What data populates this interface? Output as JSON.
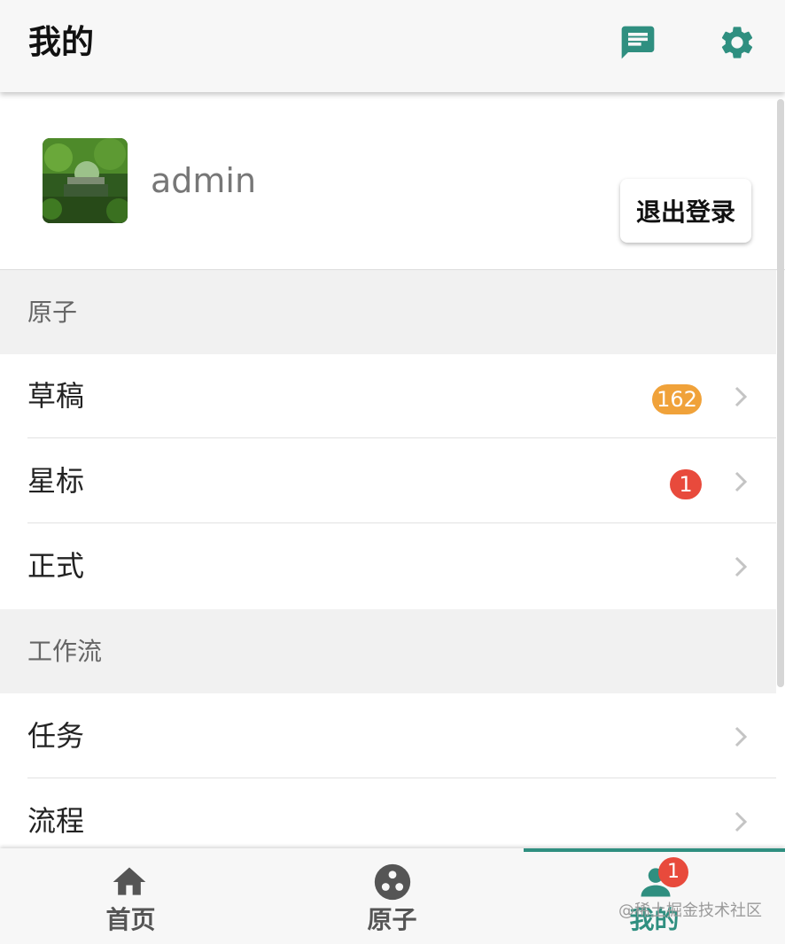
{
  "header": {
    "title": "我的",
    "icons": [
      "message-icon",
      "settings-icon"
    ],
    "accent_color": "#2f8f80"
  },
  "profile": {
    "username": "admin",
    "logout_label": "退出登录"
  },
  "sections": [
    {
      "title": "原子",
      "items": [
        {
          "label": "草稿",
          "badge": "162",
          "badge_color": "#f0a23a"
        },
        {
          "label": "星标",
          "badge": "1",
          "badge_color": "#e84a3c"
        },
        {
          "label": "正式"
        }
      ]
    },
    {
      "title": "工作流",
      "items": [
        {
          "label": "任务"
        },
        {
          "label": "流程"
        }
      ]
    }
  ],
  "tabbar": {
    "tabs": [
      {
        "label": "首页",
        "icon": "home-icon"
      },
      {
        "label": "原子",
        "icon": "atom-icon"
      },
      {
        "label": "我的",
        "icon": "person-icon",
        "badge": "1",
        "active": true
      }
    ]
  },
  "watermark": "@稀土掘金技术社区"
}
